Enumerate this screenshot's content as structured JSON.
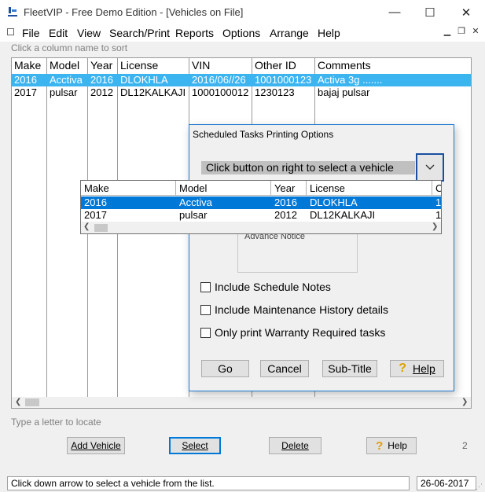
{
  "window": {
    "title": "FleetVIP - Free Demo Edition - [Vehicles on File]",
    "controls": {
      "minimize": "—",
      "maximize": "☐",
      "close": "✕"
    }
  },
  "menu": [
    "File",
    "Edit",
    "View",
    "Search/Print",
    "Reports",
    "Options",
    "Arrange",
    "Help"
  ],
  "hints": {
    "top": "Click a column name to sort",
    "bottom": "Type a letter to locate"
  },
  "grid": {
    "columns": [
      "Make",
      "Model",
      "Year",
      "License",
      "VIN",
      "Other ID",
      "Comments"
    ],
    "rows": [
      [
        "2016",
        "Acctiva",
        "2016",
        "DLOKHLA",
        "2016/06//26",
        "1001000123",
        "Activa 3g ......."
      ],
      [
        "2017",
        "pulsar",
        "2012",
        "DL12KALKAJI",
        "1000100012",
        "1230123",
        "bajaj pulsar"
      ]
    ],
    "selected_row": 0
  },
  "buttons": {
    "add_vehicle": "Add Vehicle",
    "select": "Select",
    "delete": "Delete",
    "help": "Help"
  },
  "page_number": "2",
  "statusbar": {
    "message": "Click down arrow to select a vehicle from the list.",
    "date": "26-06-2017"
  },
  "dialog": {
    "title": "Scheduled Tasks Printing Options",
    "combo_text": "Click button on right to select a vehicle",
    "notice_label": "Advance Notice",
    "checkboxes": [
      {
        "label": "Include Schedule Notes",
        "checked": false
      },
      {
        "label": "Include Maintenance History details",
        "checked": false
      },
      {
        "label": "Only print Warranty Required tasks",
        "checked": false
      }
    ],
    "buttons": {
      "go": "Go",
      "cancel": "Cancel",
      "subtitle": "Sub-Title",
      "help": "Help"
    }
  },
  "dropdown": {
    "columns": [
      "Make",
      "Model",
      "Year",
      "License",
      "C"
    ],
    "rows": [
      [
        "2016",
        "Acctiva",
        "2016",
        "DLOKHLA",
        "1("
      ],
      [
        "2017",
        "pulsar",
        "2012",
        "DL12KALKAJI",
        "1:"
      ]
    ],
    "selected_row": 0
  },
  "colors": {
    "accent": "#0078d7",
    "grid_selection": "#3cb4f0",
    "dialog_border": "#1e78d2"
  }
}
